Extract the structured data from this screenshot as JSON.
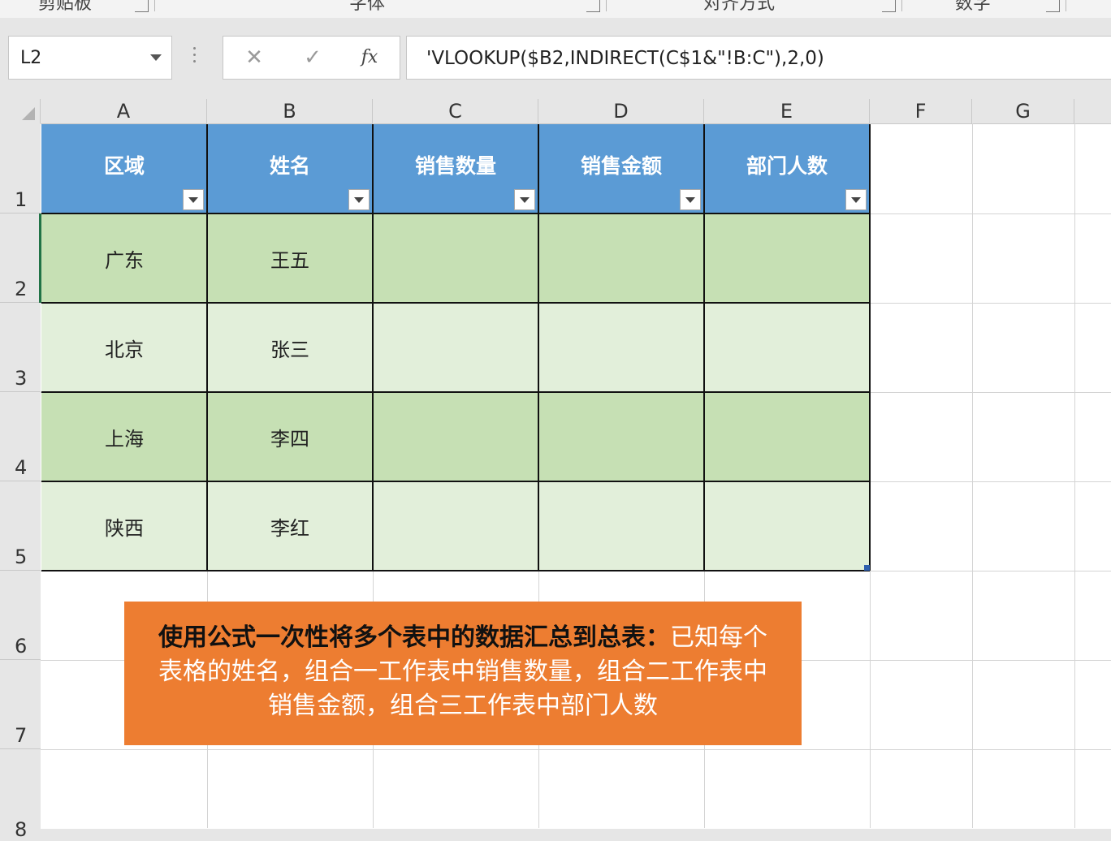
{
  "ribbon": {
    "groups": [
      "剪贴板",
      "字体",
      "对齐方式",
      "数字"
    ]
  },
  "formula_bar": {
    "name_box": "L2",
    "cancel_glyph": "✕",
    "enter_glyph": "✓",
    "fx_label": "fx",
    "formula": "'VLOOKUP($B2,INDIRECT(C$1&\"!B:C\"),2,0)"
  },
  "columns": [
    "A",
    "B",
    "C",
    "D",
    "E",
    "F",
    "G"
  ],
  "rows": [
    "1",
    "2",
    "3",
    "4",
    "5",
    "6",
    "7",
    "8"
  ],
  "table": {
    "headers": [
      "区域",
      "姓名",
      "销售数量",
      "销售金额",
      "部门人数"
    ],
    "data": [
      [
        "广东",
        "王五",
        "",
        "",
        ""
      ],
      [
        "北京",
        "张三",
        "",
        "",
        ""
      ],
      [
        "上海",
        "李四",
        "",
        "",
        ""
      ],
      [
        "陕西",
        "李红",
        "",
        "",
        ""
      ]
    ]
  },
  "callout": {
    "bold": "使用公式一次性将多个表中的数据汇总到总表：",
    "text": "已知每个表格的姓名，组合一工作表中销售数量，组合二工作表中销售金额，组合三工作表中部门人数"
  },
  "colors": {
    "header_blue": "#5b9bd5",
    "band_dark": "#c6e0b4",
    "band_light": "#e2efda",
    "callout_orange": "#ed7d31"
  }
}
